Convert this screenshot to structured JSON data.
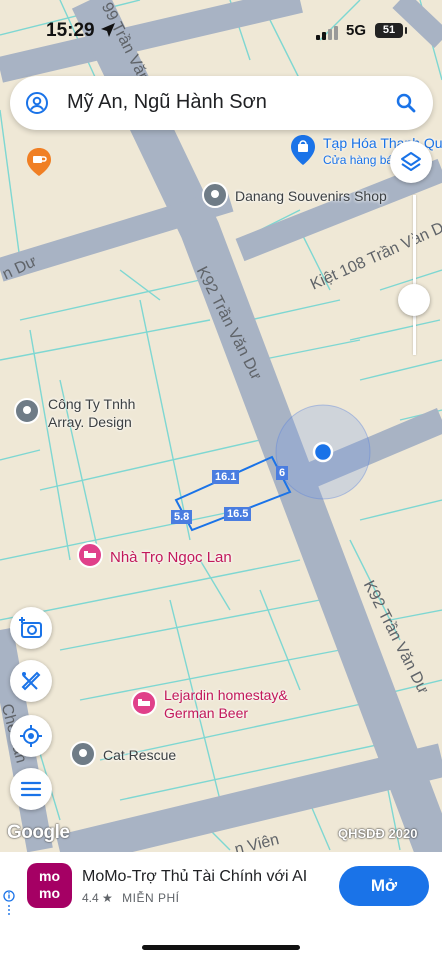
{
  "status_bar": {
    "time": "15:29",
    "network": "5G",
    "battery": "51"
  },
  "search": {
    "query": "Mỹ An, Ngũ Hành Sơn"
  },
  "pois": {
    "tap_hoa_name": "Tạp Hóa Thanh Qu",
    "tap_hoa_sub": "Cửa hàng bá",
    "souvenirs": "Danang Souvenirs Shop",
    "array_line1": "Công Ty Tnhh",
    "array_line2": "Array. Design",
    "nha_tro": "Nhà Trọ Ngọc Lan",
    "lejardin_line1": "Lejardin homestay&",
    "lejardin_line2": "German Beer",
    "cat_rescue": "Cat Rescue"
  },
  "streets": {
    "tran_van_du_top": "99 Trần Văn",
    "left_du": "n Dư",
    "kiet_108": "Kiệt 108 Trần Văn D",
    "k92_upper": "K92 Trần Văn Dư",
    "k92_lower": "K92 Trần Văn Dư",
    "left_bottom": "Chế Lan",
    "bottom_vien": "n Viên"
  },
  "measurements": {
    "top": "16.1",
    "right": "6",
    "left": "5.8",
    "bottom": "16.5"
  },
  "map_footer": {
    "logo": "Google",
    "layer_credit": "QHSDĐ 2020"
  },
  "ad": {
    "logo_line1": "mo",
    "logo_line2": "mo",
    "title": "MoMo-Trợ Thủ Tài Chính với AI",
    "rating": "4.4",
    "price": "MIỄN PHÍ",
    "cta": "Mở"
  },
  "colors": {
    "road": "#a8b3c4",
    "land": "#efe8d6",
    "parcel_line": "#7ed7d2",
    "accent": "#1a73e8",
    "momo": "#a50064"
  }
}
